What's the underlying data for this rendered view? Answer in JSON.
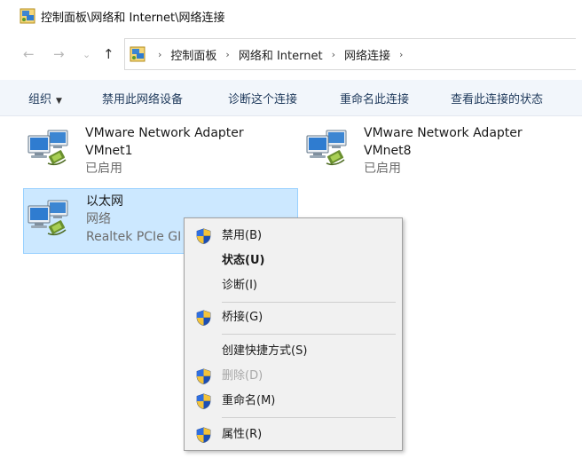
{
  "window": {
    "title": "控制面板\\网络和 Internet\\网络连接"
  },
  "nav": {
    "back": "←",
    "forward": "→",
    "recent": "⌄",
    "up": "↑",
    "breadcrumb": [
      "控制面板",
      "网络和 Internet",
      "网络连接"
    ],
    "separator": "›"
  },
  "toolbar": {
    "organize": "组织",
    "disable": "禁用此网络设备",
    "diagnose": "诊断这个连接",
    "rename": "重命名此连接",
    "status": "查看此连接的状态"
  },
  "connections": [
    {
      "name": "VMware Network Adapter",
      "line2": "VMnet1",
      "status": "已启用"
    },
    {
      "name": "VMware Network Adapter",
      "line2": "VMnet8",
      "status": "已启用"
    },
    {
      "name": "以太网",
      "line2": "网络",
      "device": "Realtek PCIe GI"
    }
  ],
  "context_menu": {
    "items": [
      {
        "label": "禁用(B)",
        "icon": "uac-shield-icon"
      },
      {
        "label": "状态(U)",
        "default": true
      },
      {
        "label": "诊断(I)"
      },
      {
        "label": "桥接(G)",
        "icon": "uac-shield-icon"
      },
      {
        "label": "创建快捷方式(S)"
      },
      {
        "label": "删除(D)",
        "icon": "uac-shield-icon",
        "disabled": true
      },
      {
        "label": "重命名(M)",
        "icon": "uac-shield-icon"
      },
      {
        "label": "属性(R)",
        "icon": "uac-shield-icon"
      }
    ]
  },
  "colors": {
    "selection": "#cce8ff",
    "toolbar_bg": "#f2f6fb",
    "toolbar_text": "#1e395b"
  }
}
